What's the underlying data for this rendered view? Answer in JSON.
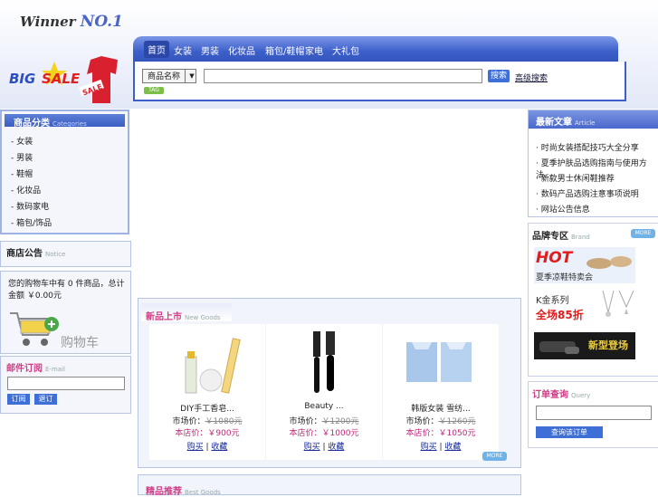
{
  "logo": {
    "text": "Winner",
    "suffix": "NO.1"
  },
  "nav": {
    "items": [
      "首页",
      "女装",
      "男装",
      "化妆品",
      "箱包/鞋帽",
      "家电",
      "大礼包"
    ]
  },
  "search": {
    "select_value": "商品名称",
    "button_label": "搜索",
    "advanced_link": "高级搜索",
    "tag_label": "TAG"
  },
  "banner": {
    "big": "BIG",
    "sale": "SALE"
  },
  "categories": {
    "title": "商品分类",
    "subtitle": "Categories",
    "items": [
      "女装",
      "男装",
      "鞋帽",
      "化妆品",
      "数码家电",
      "箱包/饰品"
    ]
  },
  "notice": {
    "title": "商店公告",
    "subtitle": "Notice"
  },
  "cart": {
    "summary": "您的购物车中有 0 件商品，总计金额 ￥0.00元",
    "label": "购物车"
  },
  "subscribe": {
    "title": "邮件订阅",
    "subtitle": "E-mail",
    "buttons": [
      "订阅",
      "退订"
    ]
  },
  "articles": {
    "title": "最新文章",
    "subtitle": "Article",
    "items": [
      "时尚女装搭配技巧大全分享",
      "夏季护肤品选购指南与使用方法…",
      "新款男士休闲鞋推荐",
      "数码产品选购注意事项说明",
      "网站公告信息"
    ]
  },
  "brand": {
    "title": "品牌专区",
    "subtitle": "Brand",
    "more": "MORE",
    "banners": [
      "HOT",
      "夏季凉鞋特卖会",
      "K金系列",
      "全场85折",
      "新型登场"
    ]
  },
  "order_query": {
    "title": "订单查询",
    "subtitle": "Query",
    "button": "查询该订单"
  },
  "new_goods": {
    "title": "新品上市",
    "subtitle": "New Goods",
    "more": "MORE",
    "products": [
      {
        "name": "DIY手工香皂...",
        "market_label": "市场价：",
        "market_price": "￥1080元",
        "sale_label": "本店价：",
        "sale_price": "￥900元",
        "links": [
          "购买",
          "收藏"
        ]
      },
      {
        "name": "Beauty ...",
        "market_label": "市场价：",
        "market_price": "￥1200元",
        "sale_label": "本店价：",
        "sale_price": "￥1000元",
        "links": [
          "购买",
          "收藏"
        ]
      },
      {
        "name": "韩版女装 雪纺...",
        "market_label": "市场价：",
        "market_price": "￥1260元",
        "sale_label": "本店价：",
        "sale_price": "￥1050元",
        "links": [
          "购买",
          "收藏"
        ]
      }
    ]
  },
  "best_goods": {
    "title": "精品推荐",
    "subtitle": "Best Goods"
  },
  "colors": {
    "accent": "#3d5fc9",
    "pink": "#d23c86",
    "sale": "#c0267a"
  }
}
